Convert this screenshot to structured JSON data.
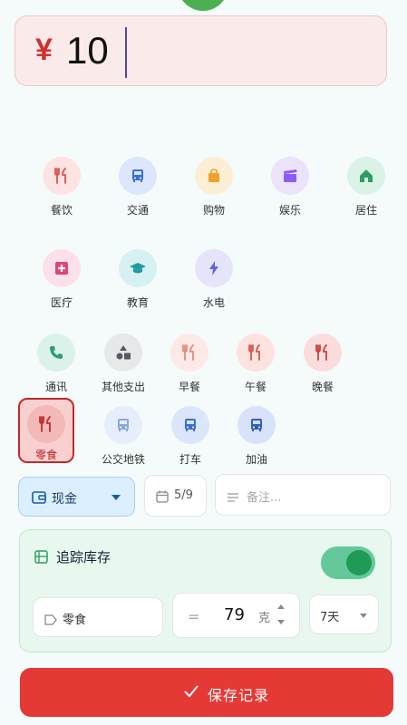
{
  "amount": {
    "currency": "¥",
    "value": "10"
  },
  "categories": [
    {
      "label": "餐饮",
      "icon": "fork-knife-icon",
      "bg": "#fde3e1",
      "fg": "#d9534f"
    },
    {
      "label": "交通",
      "icon": "bus-icon",
      "bg": "#dde7fb",
      "fg": "#3b6fcf"
    },
    {
      "label": "购物",
      "icon": "shopping-bag-icon",
      "bg": "#fcefd4",
      "fg": "#f0a12b"
    },
    {
      "label": "娱乐",
      "icon": "clapperboard-icon",
      "bg": "#ece2fb",
      "fg": "#8b5cf6"
    },
    {
      "label": "居住",
      "icon": "home-icon",
      "bg": "#daf3e6",
      "fg": "#2e9d63"
    },
    {
      "label": "医疗",
      "icon": "medical-cross-icon",
      "bg": "#fde0ea",
      "fg": "#e0447a"
    },
    {
      "label": "教育",
      "icon": "graduation-cap-icon",
      "bg": "#d6f1f1",
      "fg": "#1f9aa0"
    },
    {
      "label": "水电",
      "icon": "lightning-icon",
      "bg": "#e6e4fb",
      "fg": "#6464d8"
    },
    {
      "label": "通讯",
      "icon": "phone-icon",
      "bg": "#dbf2ea",
      "fg": "#2e9d74"
    },
    {
      "label": "其他支出",
      "icon": "shapes-icon",
      "bg": "#e6e8ea",
      "fg": "#555b62"
    },
    {
      "label": "早餐",
      "icon": "fork-knife-icon",
      "bg": "#fdeae6",
      "fg": "#e58a78"
    },
    {
      "label": "午餐",
      "icon": "fork-knife-icon",
      "bg": "#fde3e0",
      "fg": "#d9534f"
    },
    {
      "label": "晚餐",
      "icon": "fork-knife-icon",
      "bg": "#fbdcdc",
      "fg": "#c94040"
    },
    {
      "label": "零食",
      "icon": "fork-knife-icon",
      "bg": "#f3b9b9",
      "fg": "#c02a2a",
      "selected": true
    },
    {
      "label": "公交地铁",
      "icon": "bus-icon",
      "bg": "#e6eefb",
      "fg": "#8aa8e0"
    },
    {
      "label": "打车",
      "icon": "bus-icon",
      "bg": "#dce6fb",
      "fg": "#3b6fcf"
    },
    {
      "label": "加油",
      "icon": "bus-icon",
      "bg": "#d8e2fa",
      "fg": "#2e5fc4"
    }
  ],
  "payment": {
    "label": "现金"
  },
  "date": {
    "label": "5/9"
  },
  "note": {
    "placeholder": "备注..."
  },
  "tracking": {
    "title": "追踪库存",
    "enabled": true,
    "item_name": "零食",
    "quantity": "79",
    "unit": "克",
    "duration": "7天"
  },
  "save_button": {
    "label": "保存记录"
  },
  "colors": {
    "accent_red": "#e53935",
    "toggle_green": "#1f9b57"
  }
}
